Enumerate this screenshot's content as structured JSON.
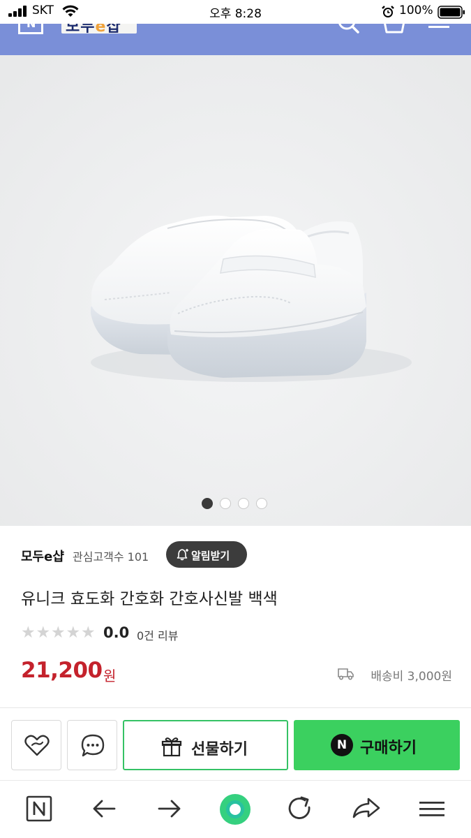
{
  "status_bar": {
    "carrier": "SKT",
    "time": "오후 8:28",
    "battery": "100%"
  },
  "header": {
    "brand_logo_text": "모두e샵",
    "icons": [
      "naver-n-icon",
      "search-icon",
      "cart-icon",
      "menu-icon"
    ],
    "background_color": "#7a8fd8"
  },
  "product": {
    "image_alt": "흰색 간호화",
    "carousel": {
      "total": 4,
      "active_index": 0
    },
    "store_name": "모두e샵",
    "followers_label": "관심고객수 101",
    "alarm_button": "알림받기",
    "title": "유니크 효도화 간호화 간호사신발 백색",
    "rating": {
      "score": "0.0",
      "stars_filled": 0,
      "stars_total": 5
    },
    "review_count": "0건 리뷰",
    "price": "21,200",
    "price_unit": "원",
    "shipping": "배송비 3,000원",
    "price_color": "#c4222c"
  },
  "actions": {
    "like_icon": "heart-icon",
    "talk_icon": "talk-bubble-icon",
    "gift_label": "선물하기",
    "buy_badge": "N",
    "buy_label": "구매하기",
    "buy_color": "#3bd05f"
  },
  "bottom_nav": {
    "items": [
      "naver-home-icon",
      "back-arrow-icon",
      "forward-arrow-icon",
      "green-dot-home-icon",
      "reload-icon",
      "share-icon",
      "menu-icon"
    ]
  }
}
